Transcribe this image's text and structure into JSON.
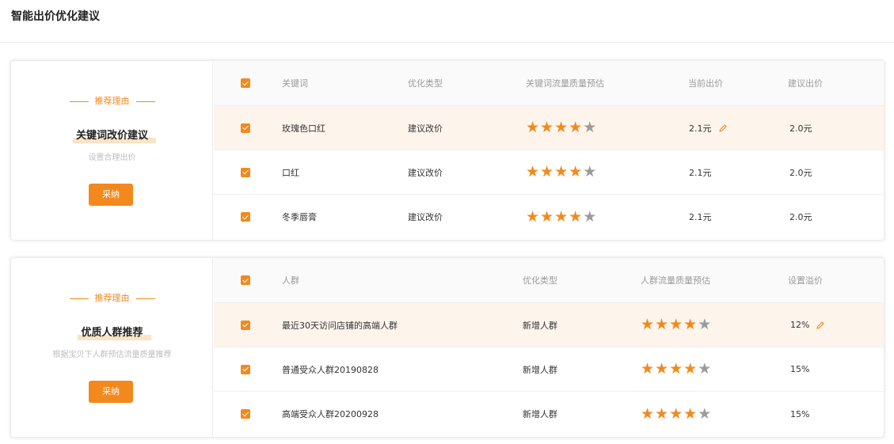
{
  "page_title": "智能出价优化建议",
  "colors": {
    "accent": "#f3891c",
    "row_highlight": "#fdf4ec",
    "star_off": "#9b9b9b"
  },
  "cards": [
    {
      "reason_tag": "推荐理由",
      "reason_title": "关键词改价建议",
      "reason_desc": "设置合理出价",
      "adopt_label": "采纳",
      "columns": [
        "关键词",
        "优化类型",
        "关键词流量质量预估",
        "当前出价",
        "建议出价"
      ],
      "rows": [
        {
          "name": "玫瑰色口红",
          "type": "建议改价",
          "rating": 4,
          "rating_max": 5,
          "current_bid": "2.1元",
          "suggested_bid": "2.0元",
          "editable": true
        },
        {
          "name": "口红",
          "type": "建议改价",
          "rating": 4,
          "rating_max": 5,
          "current_bid": "2.1元",
          "suggested_bid": "2.0元",
          "editable": false
        },
        {
          "name": "冬季唇膏",
          "type": "建议改价",
          "rating": 4,
          "rating_max": 5,
          "current_bid": "2.1元",
          "suggested_bid": "2.0元",
          "editable": false
        }
      ]
    },
    {
      "reason_tag": "推荐理由",
      "reason_title": "优质人群推荐",
      "reason_desc": "根据宝贝下人群预估流量质量推荐",
      "adopt_label": "采纳",
      "columns": [
        "人群",
        "优化类型",
        "人群流量质量预估",
        "设置溢价"
      ],
      "rows": [
        {
          "name": "最近30天访问店铺的高端人群",
          "type": "新增人群",
          "rating": 4,
          "rating_max": 5,
          "premium": "12%",
          "editable": true
        },
        {
          "name": "普通受众人群20190828",
          "type": "新增人群",
          "rating": 4,
          "rating_max": 5,
          "premium": "15%",
          "editable": false
        },
        {
          "name": "高端受众人群20200928",
          "type": "新增人群",
          "rating": 4,
          "rating_max": 5,
          "premium": "15%",
          "editable": false
        }
      ]
    }
  ]
}
